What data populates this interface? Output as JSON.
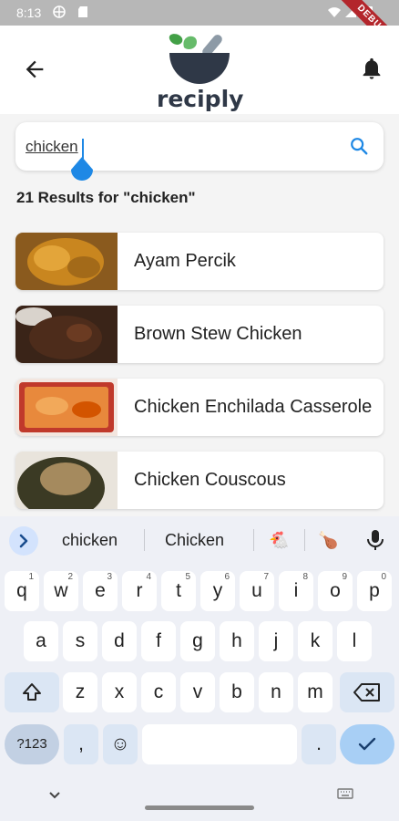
{
  "status_bar": {
    "time": "8:13",
    "debug_label": "DEBUG"
  },
  "app_bar": {
    "logo_text": "reciply",
    "back_icon": "arrow-back-icon",
    "bell_icon": "notifications-bell-icon"
  },
  "search": {
    "query": "chicken",
    "placeholder": "",
    "icon": "search-icon"
  },
  "results": {
    "title": "21 Results for \"chicken\"",
    "items": [
      {
        "name": "Ayam Percik"
      },
      {
        "name": "Brown Stew Chicken"
      },
      {
        "name": "Chicken Enchilada Casserole"
      },
      {
        "name": "Chicken Couscous"
      }
    ]
  },
  "keyboard": {
    "suggestions": [
      "chicken",
      "Chicken",
      "🐔",
      "🍗"
    ],
    "row1": [
      "q",
      "w",
      "e",
      "r",
      "t",
      "y",
      "u",
      "i",
      "o",
      "p"
    ],
    "row1_hints": [
      "1",
      "2",
      "3",
      "4",
      "5",
      "6",
      "7",
      "8",
      "9",
      "0"
    ],
    "row2": [
      "a",
      "s",
      "d",
      "f",
      "g",
      "h",
      "j",
      "k",
      "l"
    ],
    "row3": [
      "z",
      "x",
      "c",
      "v",
      "b",
      "n",
      "m"
    ],
    "symbols_label": "?123",
    "comma": ",",
    "period": ".",
    "emoji": "☺"
  },
  "colors": {
    "accent": "#1e88e5",
    "brand_dark": "#2f3847",
    "brand_green": "#4caf50"
  }
}
